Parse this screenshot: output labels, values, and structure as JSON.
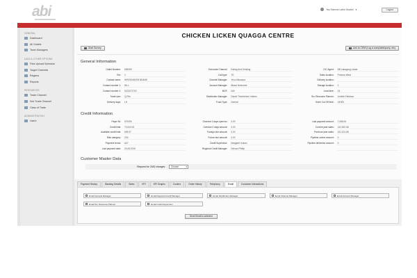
{
  "header": {
    "logo_text": "abi",
    "user_text": "Yes Science Lathe Sealed",
    "logout_label": "Logout"
  },
  "sidebar": {
    "groups": [
      {
        "title": "General",
        "items": [
          "Dashboard",
          "All Outlets",
          "Team Managers"
        ]
      },
      {
        "title": "Data & Other Options",
        "items": [
          "Files Upload Schedule",
          "Target Channels",
          "Regions",
          "Reports"
        ]
      },
      {
        "title": "Resources",
        "items": [
          "Trade Channel",
          "Sub Trade Channel",
          "Class of Trade"
        ]
      },
      {
        "title": "Administration",
        "items": [
          "Users"
        ]
      }
    ]
  },
  "main": {
    "title": "CHICKEN LICKEN QUAGGA CENTRE",
    "start_survey_label": "Start Survey",
    "crm_link_label": "Link to CRM (Log a complaint/query, etc)",
    "general_title": "General Information",
    "general": [
      {
        "label": "Outlet Number:",
        "value": "636390"
      },
      {
        "label": "Sub-trade Channel:",
        "value": "Eating And Drinking"
      },
      {
        "label": "CIC Agent:",
        "value": "BB Lakagong Lelate"
      },
      {
        "label": "Tier:",
        "value": "2"
      },
      {
        "label": "Call type:",
        "value": "TS"
      },
      {
        "label": "Sales location:",
        "value": "Pretoria West"
      },
      {
        "label": "Contact name:",
        "value": "HIROSHAKEB NDANE"
      },
      {
        "label": "Channel Manager:",
        "value": "Yeuu Nkosana"
      },
      {
        "label": "Delivery location:",
        "value": ""
      },
      {
        "label": "Contact number 1:",
        "value": "NILL"
      },
      {
        "label": "Account Manager:",
        "value": "Bisset Nkhumbe"
      },
      {
        "label": "Storage location:",
        "value": "2"
      },
      {
        "label": "Contact number 2:",
        "value": "0123271702"
      },
      {
        "label": "MOT:",
        "value": "N/A"
      },
      {
        "label": "Lead-time:",
        "value": "24"
      },
      {
        "label": "Trade size:",
        "value": "Q-Fits"
      },
      {
        "label": "Distribution Manager:",
        "value": "Daniel Thembeleni Vriders"
      },
      {
        "label": "Srv. Resource Planner:",
        "value": "Jenifah Fetshwa"
      },
      {
        "label": "Delivery days:",
        "value": "LH"
      },
      {
        "label": "Truck Type:",
        "value": "Normal"
      },
      {
        "label": "Order Cut Off time:",
        "value": "15H00"
      }
    ],
    "credit_title": "Credit Information",
    "credit": [
      {
        "label": "Payer Nr:",
        "value": "972290"
      },
      {
        "label": "Overdue 0 days open/no:",
        "value": "0.00"
      },
      {
        "label": "Last payment amount:",
        "value": "7,086.06"
      },
      {
        "label": "Credit limit:",
        "value": "70,000.00"
      },
      {
        "label": "Overdue 0 days amount:",
        "value": "0.00"
      },
      {
        "label": "Current year sales:",
        "value": "142,822.68"
      },
      {
        "label": "Available credit limit:",
        "value": "639.97"
      },
      {
        "label": "Foreign due amount:",
        "value": "0.00"
      },
      {
        "label": "Previous year sales:",
        "value": "151,201.86"
      },
      {
        "label": "Risk category:",
        "value": "Z04"
      },
      {
        "label": "Future due amount:",
        "value": "0.00"
      },
      {
        "label": "Pipeline orders amount:",
        "value": "0"
      },
      {
        "label": "Payment terms:",
        "value": "A07"
      },
      {
        "label": "Credit Supervisor:",
        "value": "Margaret Vukosi"
      },
      {
        "label": "Pipeline deliveries amount:",
        "value": "0"
      },
      {
        "label": "Last payment date:",
        "value": "24.08.2015"
      },
      {
        "label": "Regional Credit Manager:",
        "value": "Dervan Phillip"
      },
      {
        "label": "",
        "value": ""
      }
    ],
    "cmd_title": "Customer Master Data",
    "cmd_label": "Request for CMD changes:",
    "cmd_select_value": "Choose",
    "tabs": [
      "Payment History",
      "Banking Details",
      "Sales",
      "KPI",
      "KPI Graphs",
      "Coolers",
      "Order History",
      "Telephony",
      "Email",
      "Customer Interactions"
    ],
    "active_tab": "Email",
    "email_options": [
      "Email General Manager",
      "Email Regional Credit Manager",
      "Email Distribution Manager",
      "Email Channel Manager",
      "Email Account Manager",
      "Email Srv. Resource Planner",
      "Email Credit Supervisor"
    ],
    "send_label": "Send Email to selected"
  }
}
